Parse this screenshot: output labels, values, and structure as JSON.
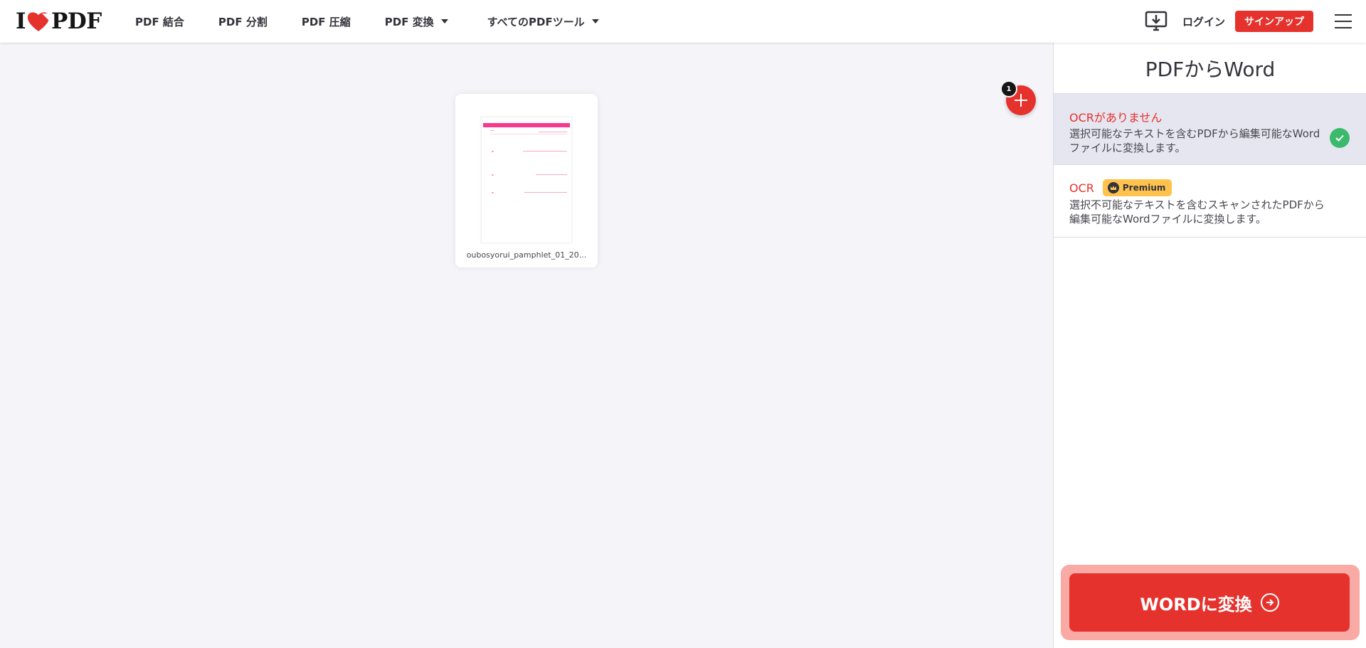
{
  "header": {
    "logo_left": "I",
    "logo_right": "PDF",
    "nav": [
      {
        "label": "PDF 結合"
      },
      {
        "label": "PDF 分割"
      },
      {
        "label": "PDF 圧縮"
      },
      {
        "label": "PDF 変換"
      },
      {
        "label": "すべてのPDFツール"
      }
    ],
    "login_label": "ログイン",
    "signup_label": "サインアップ"
  },
  "workspace": {
    "file_name": "oubosyorui_pamphlet_01_20...",
    "file_count": "1"
  },
  "sidebar": {
    "title": "PDFからWord",
    "options": [
      {
        "title": "OCRがありません",
        "description": "選択可能なテキストを含むPDFから編集可能なWordファイルに変換します。"
      },
      {
        "title": "OCR",
        "badge": "Premium",
        "description": "選択不可能なテキストを含むスキャンされたPDFから編集可能なWordファイルに変換します。"
      }
    ],
    "convert_label": "WORDに変換"
  },
  "colors": {
    "brand_red": "#e5322d",
    "check_green": "#3cba6c",
    "premium_yellow": "#ffc34d"
  }
}
